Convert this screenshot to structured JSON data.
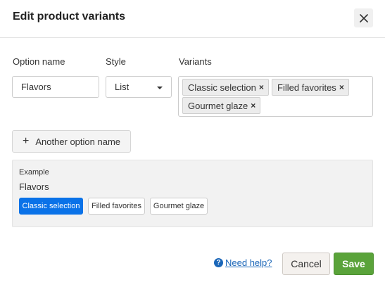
{
  "dialog": {
    "title": "Edit product variants",
    "close_icon": "close-icon"
  },
  "form": {
    "option_name_label": "Option name",
    "style_label": "Style",
    "variants_label": "Variants",
    "option_name_value": "Flavors",
    "style_value": "List",
    "variants": [
      {
        "label": "Classic selection",
        "remove": "×"
      },
      {
        "label": "Filled favorites",
        "remove": "×"
      },
      {
        "label": "Gourmet glaze",
        "remove": "×"
      }
    ]
  },
  "add_option": {
    "icon": "+",
    "label": "Another option name"
  },
  "example": {
    "label": "Example",
    "name": "Flavors",
    "chips": [
      {
        "label": "Classic selection",
        "selected": true
      },
      {
        "label": "Filled favorites",
        "selected": false
      },
      {
        "label": "Gourmet glaze",
        "selected": false
      }
    ]
  },
  "footer": {
    "help_icon": "?",
    "help_label": "Need help?",
    "cancel_label": "Cancel",
    "save_label": "Save"
  },
  "colors": {
    "accent": "#0a72e8",
    "save": "#5aa33a",
    "link": "#1a66b8"
  }
}
